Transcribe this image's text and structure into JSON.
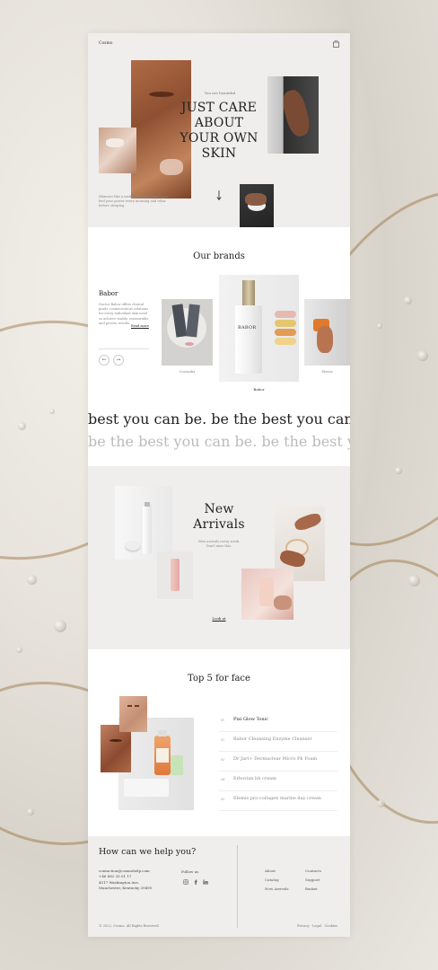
{
  "header": {
    "logo": "Cosmo",
    "bag_icon": "shopping-bag-icon"
  },
  "hero": {
    "eyebrow": "You are beautiful",
    "title_lines": [
      "JUST CARE",
      "ABOUT",
      "YOUR OWN",
      "SKIN"
    ],
    "description": "Skincare like a meditation that makes you feel your power every morning and relax before sleeping.",
    "scroll_icon": "arrow-down-icon"
  },
  "brands": {
    "heading": "Our brands",
    "active_name": "Babor",
    "active_description": "Doctor Babor offers clinical grade cosmeceutical solutions for every individual skin need so achieve visible, measurable and proven results.",
    "read_more": "Read more",
    "items": [
      {
        "label": "Cosmedix"
      },
      {
        "label": "Babor"
      },
      {
        "label": "Elemis"
      }
    ]
  },
  "marquee": {
    "line1": "best you can be. be the best you can",
    "line2": "be the best you can be. be the best yo"
  },
  "arrivals": {
    "title_lines": [
      "New",
      "Arrivals"
    ],
    "subtitle": "New arrivals every week. Don't miss this.",
    "cta": "Look at"
  },
  "top5": {
    "heading": "Top 5 for face",
    "items": [
      {
        "num": "01",
        "name": "Pixi Glow Tonic"
      },
      {
        "num": "02",
        "name": "Babor Cleansing Enzyme Cleanser"
      },
      {
        "num": "03",
        "name": "Dr Jart+ Dermaclear Micro Ph Foam"
      },
      {
        "num": "04",
        "name": "Erborian bb cream"
      },
      {
        "num": "05",
        "name": "Elemis pro-collagen marine day cream"
      }
    ]
  },
  "footer": {
    "heading": "How can we help you?",
    "email": "contaction@cosmohelp.com",
    "phone": "+46 682 35 01 17",
    "address1": "4517 Washington Ave.",
    "address2": "Manchester, Kentucky 39495",
    "follow": "Follow us",
    "col1": [
      "About",
      "Catalog",
      "New Arrivals"
    ],
    "col2": [
      "Contacts",
      "Support",
      "Basket"
    ],
    "copyright": "© 2022, Cosmo. All Rights Reserved",
    "legal": [
      "Privacy",
      "Legal",
      "Cookies"
    ],
    "sep": "·"
  }
}
